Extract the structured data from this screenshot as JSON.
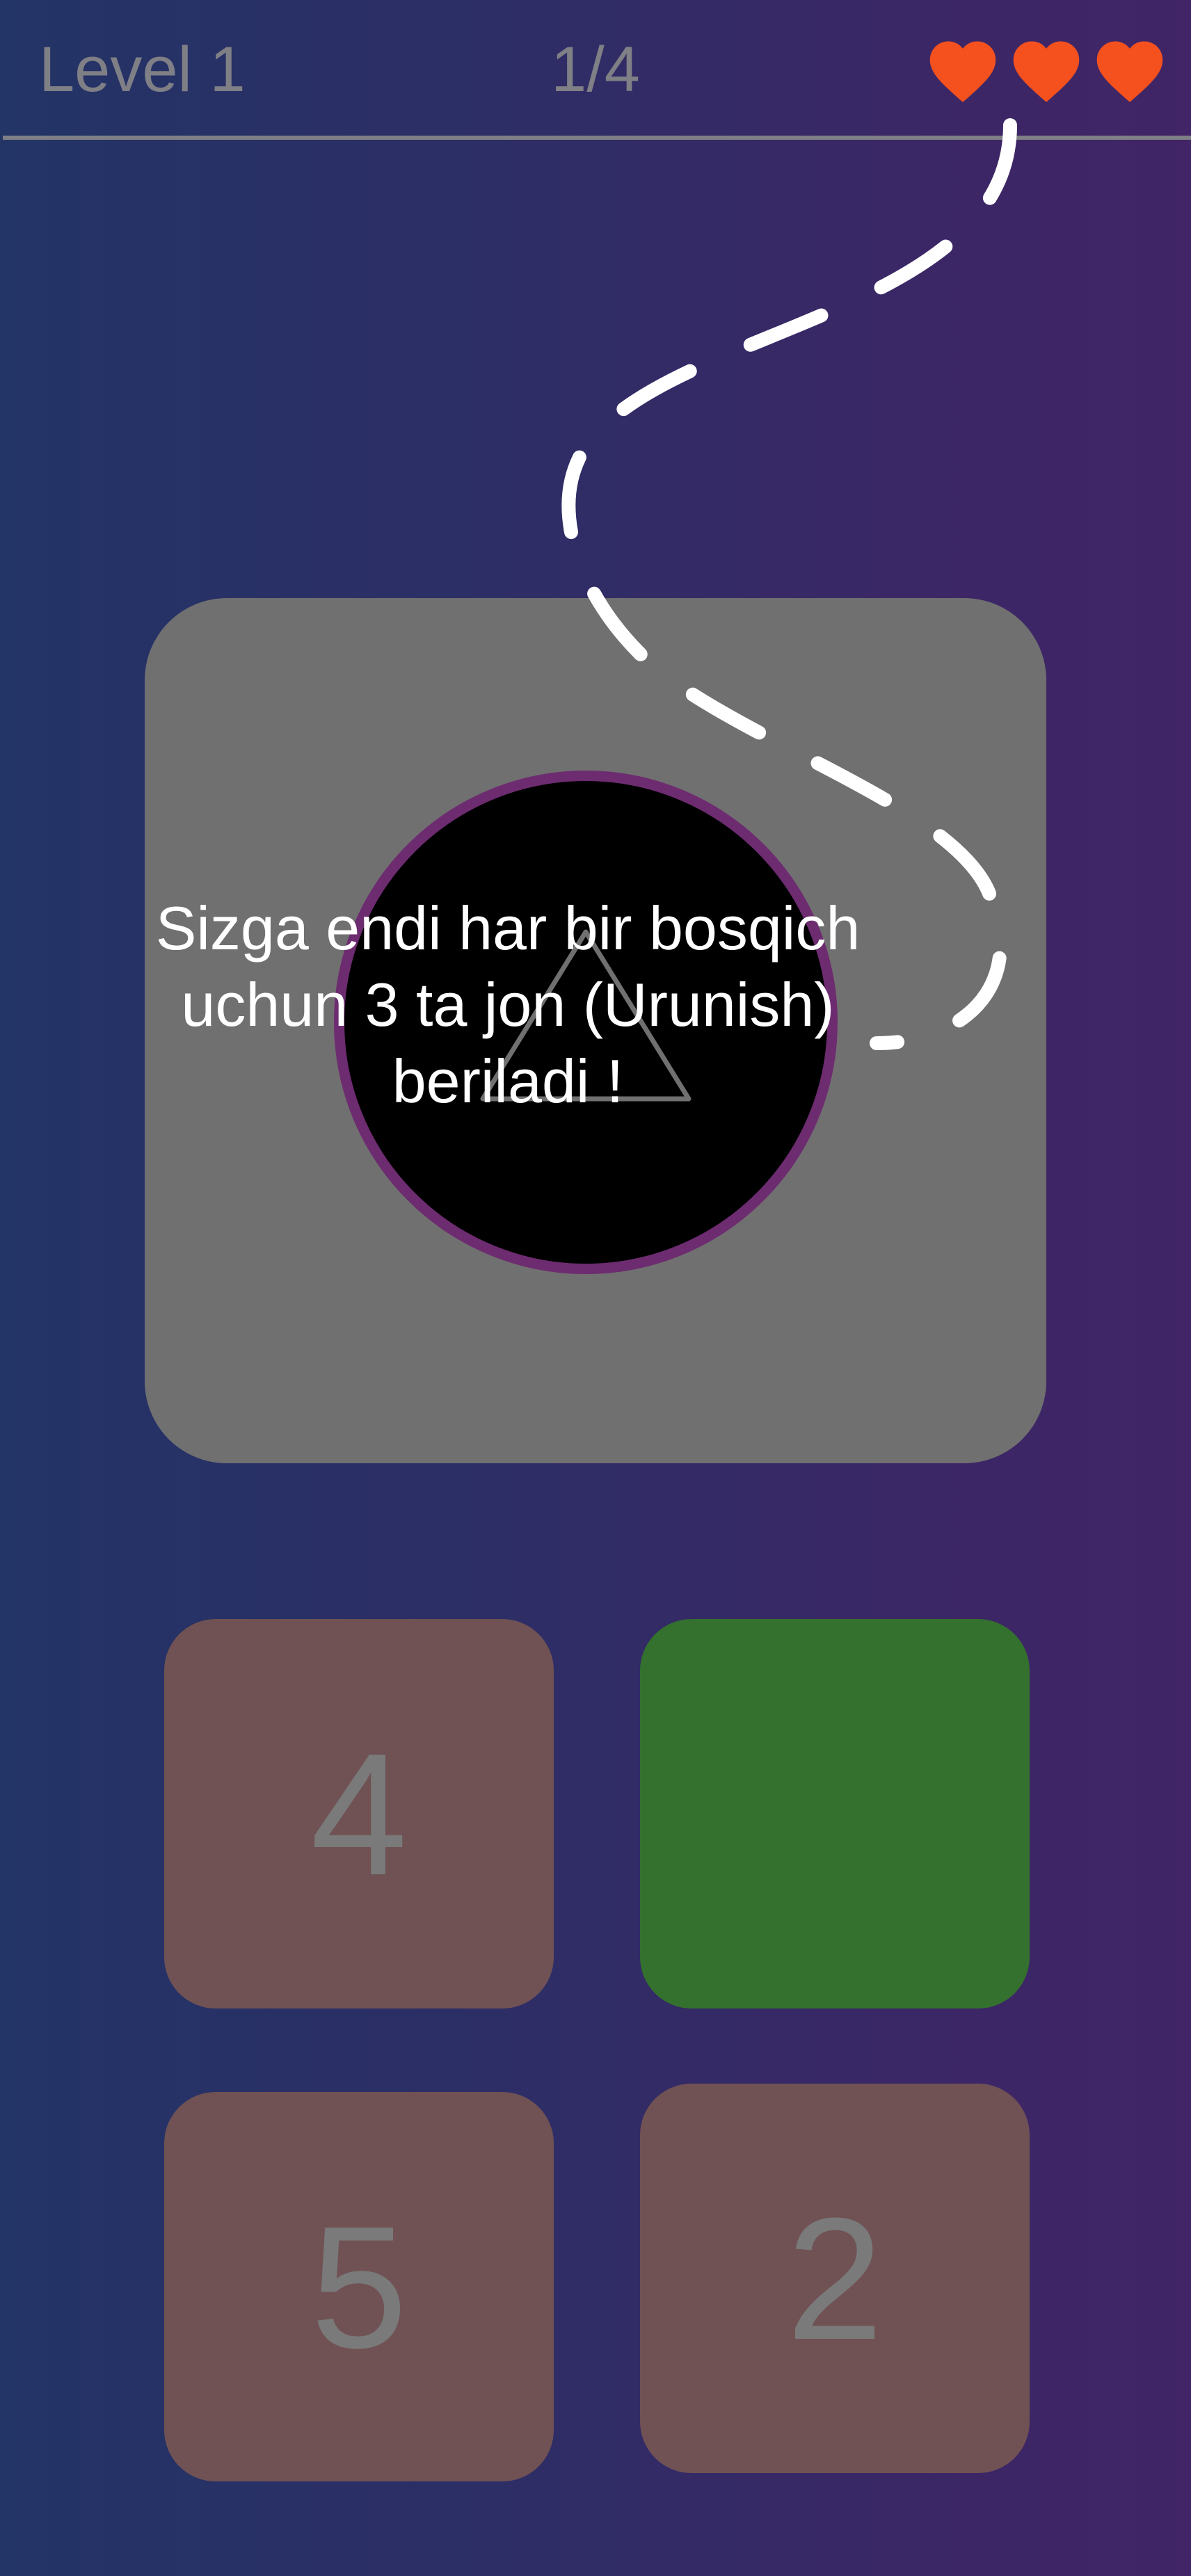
{
  "hud": {
    "level_label": "Level 1",
    "progress_label": "1/4",
    "lives": 3,
    "heart_icon": "heart-icon",
    "heart_color": "#f4511e"
  },
  "question": {
    "shape": "triangle-icon",
    "circle_border_color": "#6d2b70"
  },
  "options": [
    {
      "label": "4"
    },
    {
      "label": "",
      "state": "correct"
    },
    {
      "label": "5"
    },
    {
      "label": "2"
    }
  ],
  "tutorial": {
    "message": "Sizga endi har bir bosqich uchun 3 ta jon (Urunish) beriladi !"
  },
  "colors": {
    "card": "#707070",
    "option_tile": "#705254",
    "correct_tile": "#34702e",
    "hud_text": "#7f7f86"
  }
}
